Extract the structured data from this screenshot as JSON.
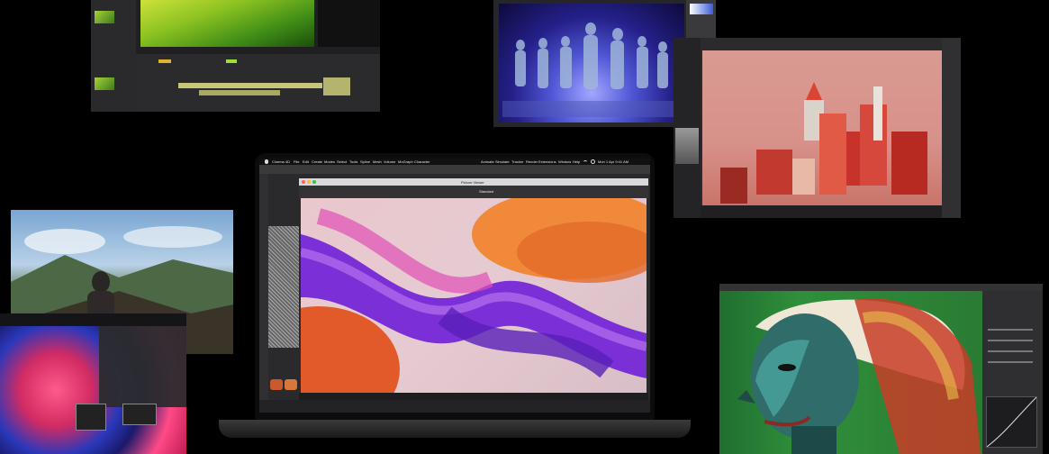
{
  "macbook": {
    "app_name": "Cinema 4D",
    "menu": [
      "File",
      "Edit",
      "Create",
      "Modes",
      "Select",
      "Tools",
      "Spline",
      "Mesh",
      "Volume",
      "MoGraph",
      "Character",
      "Animate",
      "Simulate",
      "Tracker",
      "Render",
      "Extensions",
      "Window",
      "Help"
    ],
    "clock": "Mon 1 Apr 9:41 AM",
    "viewer_title": "Picture Viewer",
    "tab": "Standard"
  },
  "icons": [
    "apple-icon",
    "wifi-icon",
    "search-icon"
  ],
  "colors": {
    "background": "#000000",
    "accent": "#3a7bd5"
  }
}
